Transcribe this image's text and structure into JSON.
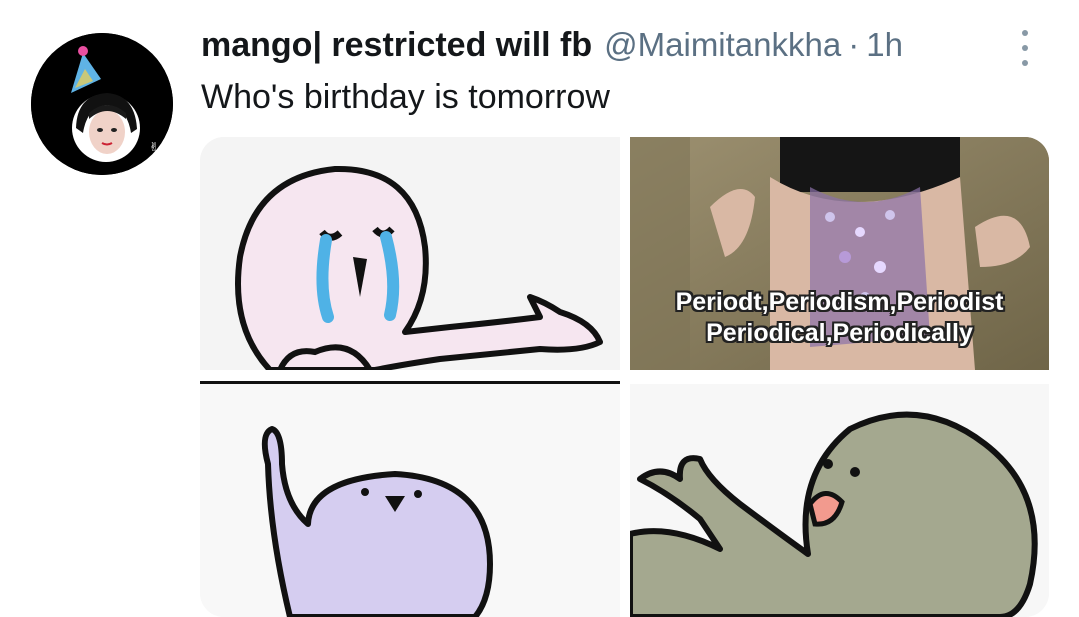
{
  "tweet": {
    "display_name": "mango| restricted will fb",
    "handle": "@Maimitankkha",
    "separator": "·",
    "time": "1h",
    "text": "Who's birthday is tomorrow"
  },
  "media": {
    "images": [
      {
        "description_icon": "crying-blob-pointing-icon"
      },
      {
        "caption_line1": "Periodt,Periodism,Periodist",
        "caption_line2": "Periodical,Periodically"
      },
      {
        "description_icon": "lavender-blob-raising-hand-icon"
      },
      {
        "description_icon": "green-blob-reaching-icon"
      }
    ]
  },
  "colors": {
    "text": "#14171a",
    "secondary": "#5b7083",
    "avatar_bg": "#000000"
  }
}
